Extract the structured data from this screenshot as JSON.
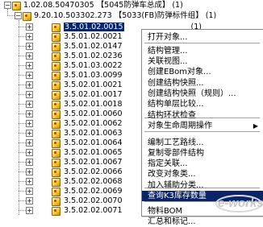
{
  "tree": {
    "root": {
      "label": "1.02.08.50470305 【5045防弹车总成】 (1)"
    },
    "child": {
      "label": "9.20.10.503302.273 【5033(FB)防弹标件组】 (1)"
    },
    "items": [
      "3.5.01.02.0015",
      "3.5.01.02.0021",
      "3.5.01.02.0147",
      "3.5.01.02.0236",
      "3.5.01.03.0022",
      "3.5.01.03.0099",
      "3.5.02.01.0021",
      "3.5.02.01.0017",
      "3.5.02.01.0018",
      "3.5.02.01.0060",
      "3.5.02.01.0062",
      "3.5.02.01.0063",
      "3.5.02.01.0064",
      "3.5.02.01.0065",
      "3.5.02.01.0067",
      "3.5.02.02.0066",
      "3.5.02.02.0068",
      "3.5.02.02.0069",
      "3.5.02.02.0070",
      "3.5.02.02.0071"
    ],
    "selected_suffix": "(1)"
  },
  "context_menu": {
    "items": [
      {
        "label": "打开对象..."
      },
      {
        "label": "结构管理..."
      },
      {
        "label": "关联视图..."
      },
      {
        "label": "创建EBom对象..."
      },
      {
        "label": "创建结构快照..."
      },
      {
        "label": "创建结构快照（规则）..."
      },
      {
        "label": "结构单层比较..."
      },
      {
        "label": "结构环状检查"
      },
      {
        "label": "对象生命周期操作"
      },
      {
        "label": "编制工艺路线..."
      },
      {
        "label": "复制零部件结构"
      },
      {
        "label": "指定关联..."
      },
      {
        "label": "改变对象类..."
      },
      {
        "label": "加入辅助分类..."
      },
      {
        "label": "查询K3库存数量"
      },
      {
        "label": "物料BOM"
      },
      {
        "label": "汇总和标记..."
      }
    ],
    "highlighted": "查询K3库存数量"
  },
  "watermark": {
    "text": "e-works"
  }
}
